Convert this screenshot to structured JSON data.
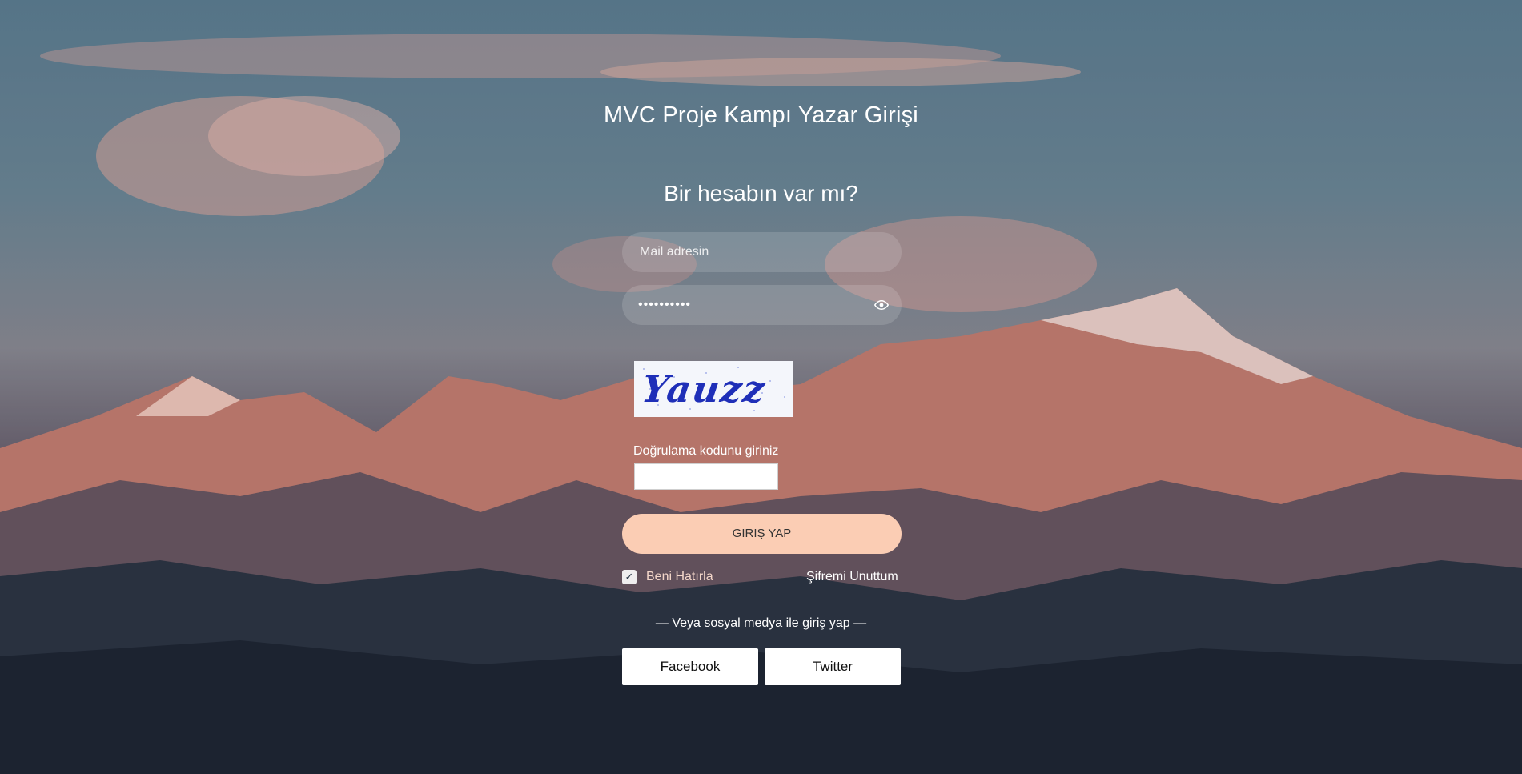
{
  "header": {
    "title": "MVC Proje Kampı Yazar Girişi",
    "subtitle": "Bir hesabın var mı?"
  },
  "form": {
    "email_placeholder": "Mail adresin",
    "password_value": "••••••••••",
    "password_toggle_icon": "eye-icon",
    "captcha_text": "Yauzz",
    "verify_label": "Doğrulama kodunu giriniz",
    "verify_value": "",
    "submit_label": "GIRIŞ YAP",
    "remember_label": "Beni Hatırla",
    "remember_checked": true,
    "forgot_label": "Şifremi Unuttum"
  },
  "social": {
    "label": "— Veya sosyal medya ile giriş yap —",
    "facebook_label": "Facebook",
    "twitter_label": "Twitter"
  },
  "colors": {
    "primary_button": "#fbcdb4",
    "field_background": "rgba(255,255,255,0.14)",
    "text": "#ffffff"
  }
}
